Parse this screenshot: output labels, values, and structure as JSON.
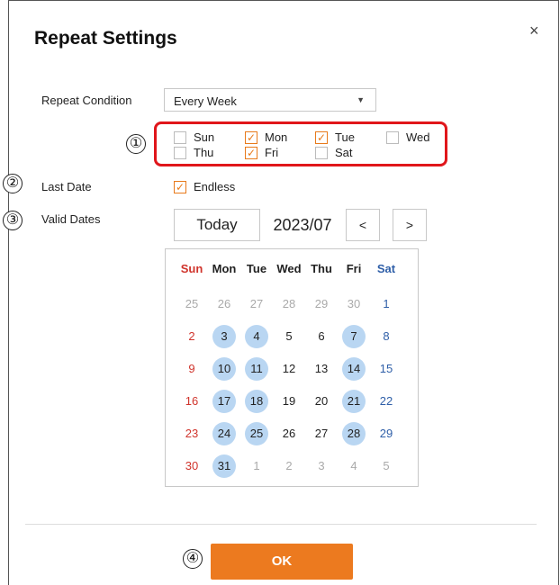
{
  "dialog": {
    "title": "Repeat Settings",
    "close_glyph": "×"
  },
  "labels": {
    "repeat_condition": "Repeat Condition",
    "last_date": "Last Date",
    "valid_dates": "Valid Dates"
  },
  "repeat_select": {
    "value": "Every Week",
    "caret": "▼"
  },
  "weekdays": [
    {
      "label": "Sun",
      "checked": false
    },
    {
      "label": "Mon",
      "checked": true
    },
    {
      "label": "Tue",
      "checked": true
    },
    {
      "label": "Wed",
      "checked": false
    },
    {
      "label": "Thu",
      "checked": false
    },
    {
      "label": "Fri",
      "checked": true
    },
    {
      "label": "Sat",
      "checked": false
    }
  ],
  "last_date": {
    "label": "Endless",
    "checked": true
  },
  "check_glyph": "✓",
  "callouts": [
    "①",
    "②",
    "③",
    "④"
  ],
  "calendar": {
    "today_label": "Today",
    "month_label": "2023/07",
    "prev_label": "<",
    "next_label": ">",
    "headers": [
      "Sun",
      "Mon",
      "Tue",
      "Wed",
      "Thu",
      "Fri",
      "Sat"
    ],
    "weeks": [
      [
        {
          "d": "25",
          "other": true
        },
        {
          "d": "26",
          "other": true
        },
        {
          "d": "27",
          "other": true
        },
        {
          "d": "28",
          "other": true
        },
        {
          "d": "29",
          "other": true
        },
        {
          "d": "30",
          "other": true
        },
        {
          "d": "1"
        }
      ],
      [
        {
          "d": "2"
        },
        {
          "d": "3",
          "sel": true
        },
        {
          "d": "4",
          "sel": true
        },
        {
          "d": "5"
        },
        {
          "d": "6"
        },
        {
          "d": "7",
          "sel": true
        },
        {
          "d": "8"
        }
      ],
      [
        {
          "d": "9"
        },
        {
          "d": "10",
          "sel": true
        },
        {
          "d": "11",
          "sel": true
        },
        {
          "d": "12"
        },
        {
          "d": "13"
        },
        {
          "d": "14",
          "sel": true
        },
        {
          "d": "15"
        }
      ],
      [
        {
          "d": "16"
        },
        {
          "d": "17",
          "sel": true
        },
        {
          "d": "18",
          "sel": true
        },
        {
          "d": "19"
        },
        {
          "d": "20"
        },
        {
          "d": "21",
          "sel": true
        },
        {
          "d": "22"
        }
      ],
      [
        {
          "d": "23"
        },
        {
          "d": "24",
          "sel": true
        },
        {
          "d": "25",
          "sel": true
        },
        {
          "d": "26"
        },
        {
          "d": "27"
        },
        {
          "d": "28",
          "sel": true
        },
        {
          "d": "29"
        }
      ],
      [
        {
          "d": "30"
        },
        {
          "d": "31",
          "sel": true
        },
        {
          "d": "1",
          "other": true
        },
        {
          "d": "2",
          "other": true
        },
        {
          "d": "3",
          "other": true
        },
        {
          "d": "4",
          "other": true
        },
        {
          "d": "5",
          "other": true
        }
      ]
    ]
  },
  "ok_label": "OK",
  "colors": {
    "accent": "#ec7a1f",
    "selected_day": "#b9d6f2",
    "highlight_border": "#e0161b",
    "sunday": "#d0342c",
    "saturday": "#2f5fa8"
  }
}
